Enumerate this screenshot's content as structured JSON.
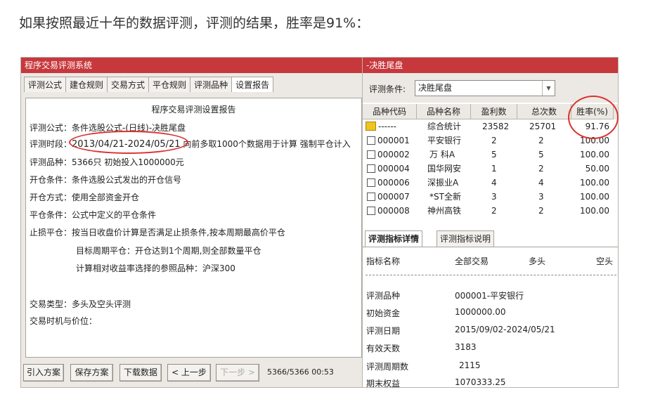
{
  "article": {
    "text": "如果按照最近十年的数据评测，评测的结果，胜率是91%："
  },
  "left_window": {
    "title": "程序交易评测系统",
    "tabs": [
      "评测公式",
      "建仓规则",
      "交易方式",
      "平仓规则",
      "评测品种",
      "设置报告"
    ],
    "report": {
      "title": "程序交易评测设置报告",
      "formula": "评测公式：条件选股公式-(日线)-决胜尾盘",
      "period_label": "评测时段：",
      "period_range": "2013/04/21-2024/05/21",
      "period_note": " 向前多取1000个数据用于计算 强制平仓计入",
      "varieties": "评测品种：5366只 初始投入1000000元",
      "open_condition": "开仓条件：条件选股公式发出的开仓信号",
      "open_method": "开仓方式：使用全部资金开仓",
      "close_condition": "平仓条件：公式中定义的平仓条件",
      "stop_loss": "止损平仓：按当日收盘价计算是否满足止损条件,按本周期最高价平仓",
      "target_period": "目标周期平仓：开仓达到1个周期,则全部数量平仓",
      "benchmark": "计算相对收益率选择的参照品种：沪深300",
      "trade_type": "交易类型：多头及空头评测",
      "trade_timing": "交易时机与价位："
    },
    "buttons": {
      "import": "引入方案",
      "save": "保存方案",
      "download": "下载数据",
      "prev": "< 上一步",
      "next": "下一步 >"
    },
    "status": "5366/5366  00:53"
  },
  "right_window": {
    "title": "-决胜尾盘",
    "condition_label": "评测条件:",
    "condition_value": "决胜尾盘",
    "grid_headers": [
      "品种代码",
      "品种名称",
      "盈利数",
      "总次数",
      "胜率(%)"
    ],
    "summary_row": {
      "code": "------",
      "name": "综合统计",
      "wins": "23582",
      "total": "25701",
      "rate": "91.76"
    },
    "rows": [
      {
        "code": "000001",
        "name": "平安银行",
        "wins": "2",
        "total": "2",
        "rate": "100.00"
      },
      {
        "code": "000002",
        "name": "万 科A",
        "wins": "5",
        "total": "5",
        "rate": "100.00"
      },
      {
        "code": "000004",
        "name": "国华网安",
        "wins": "1",
        "total": "2",
        "rate": "50.00"
      },
      {
        "code": "000006",
        "name": "深振业A",
        "wins": "4",
        "total": "4",
        "rate": "100.00"
      },
      {
        "code": "000007",
        "name": "*ST全新",
        "wins": "3",
        "total": "3",
        "rate": "100.00"
      },
      {
        "code": "000008",
        "name": "神州高铁",
        "wins": "2",
        "total": "2",
        "rate": "100.00"
      }
    ],
    "detail_tabs": [
      "评测指标详情",
      "评测指标说明"
    ],
    "detail_headers": [
      "指标名称",
      "全部交易",
      "多头",
      "空头"
    ],
    "details": [
      {
        "name": "评测品种",
        "value": "000001-平安银行"
      },
      {
        "name": "初始资金",
        "value": "1000000.00"
      },
      {
        "name": "评测日期",
        "value": "2015/09/02-2024/05/21"
      },
      {
        "name": "有效天数",
        "value": "3183"
      },
      {
        "name": "评测周期数",
        "value": "2115"
      },
      {
        "name": "期末权益",
        "value": "1070333.25"
      }
    ]
  },
  "colors": {
    "titlebar": "#c7383c",
    "highlight_ring": "#d9322e"
  },
  "icons": [
    "summary-icon",
    "checkbox-icon",
    "dropdown-arrow-icon"
  ]
}
